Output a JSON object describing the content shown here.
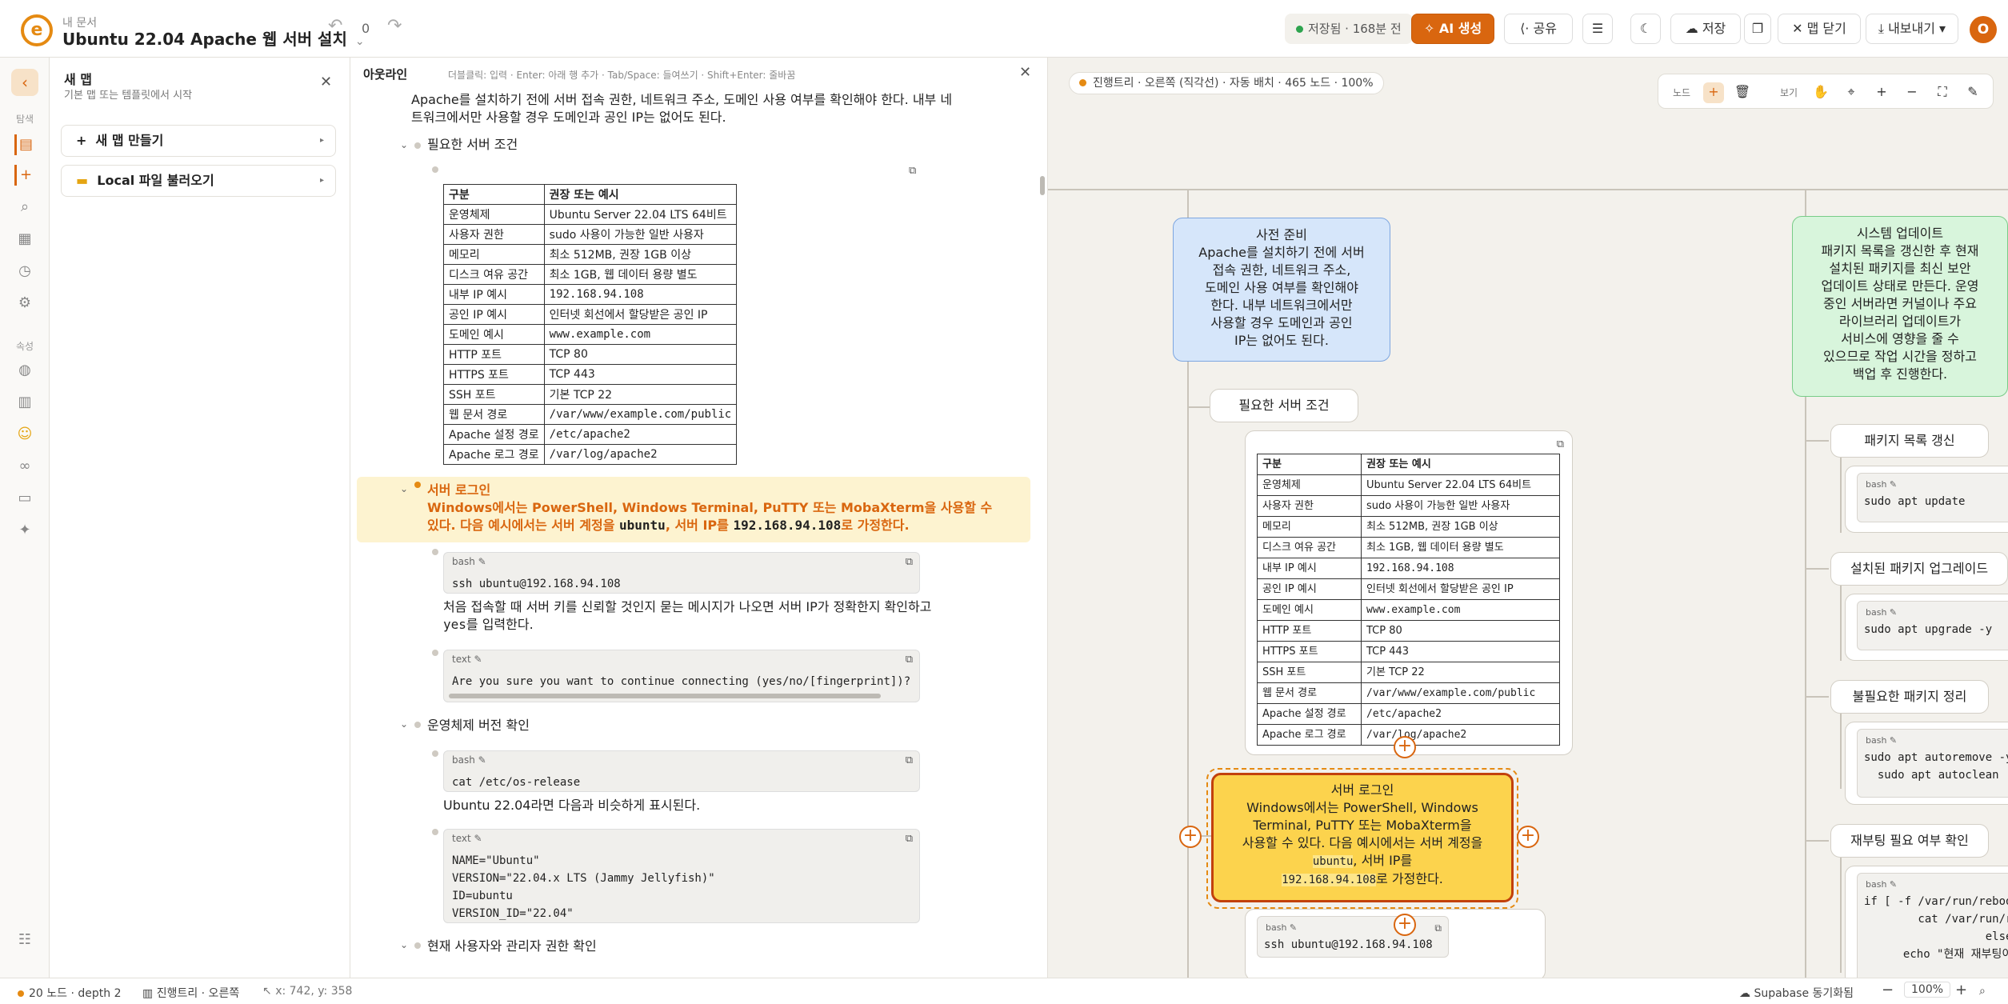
{
  "header": {
    "breadcrumb": "내 문서",
    "title": "Ubuntu 22.04 Apache 웹 서버 설치",
    "history_count": "0",
    "saved_status": "저장됨 · 168분 전",
    "ai_label": "AI 생성",
    "share_label": "공유",
    "save_label": "저장",
    "close_map_label": "맵 닫기",
    "export_label": "내보내기",
    "avatar_initial": "O"
  },
  "rail": {
    "nav_label": "탐색",
    "attr_label": "속성"
  },
  "sidebar": {
    "title": "새 맵",
    "subtitle": "기본 맵 또는 템플릿에서 시작",
    "items": [
      {
        "label": "새 맵 만들기"
      },
      {
        "label": "Local 파일 불러오기"
      }
    ]
  },
  "outline": {
    "title": "아웃라인",
    "hint": "더블클릭: 입력 · Enter: 아래 행 추가 · Tab/Space: 들여쓰기 · Shift+Enter: 줄바꿈",
    "intro_l1": "Apache를 설치하기 전에 서버 접속 권한, 네트워크 주소, 도메인 사용 여부를 확인해야 한다. 내부 네",
    "intro_l2": "트워크에서만 사용할 경우 도메인과 공인 IP는 없어도 된다.",
    "req_heading": "필요한 서버 조건",
    "table_headers": [
      "구분",
      "권장 또는 예시"
    ],
    "table_rows": [
      [
        "운영체제",
        "Ubuntu Server 22.04 LTS 64비트"
      ],
      [
        "사용자 권한",
        "sudo 사용이 가능한 일반 사용자"
      ],
      [
        "메모리",
        "최소 512MB, 권장 1GB 이상"
      ],
      [
        "디스크 여유 공간",
        "최소 1GB, 웹 데이터 용량 별도"
      ],
      [
        "내부 IP 예시",
        "192.168.94.108"
      ],
      [
        "공인 IP 예시",
        "인터넷 회선에서 할당받은 공인 IP"
      ],
      [
        "도메인 예시",
        "www.example.com"
      ],
      [
        "HTTP 포트",
        "TCP 80"
      ],
      [
        "HTTPS 포트",
        "TCP 443"
      ],
      [
        "SSH 포트",
        "기본 TCP 22"
      ],
      [
        "웹 문서 경로",
        "/var/www/example.com/public"
      ],
      [
        "Apache 설정 경로",
        "/etc/apache2"
      ],
      [
        "Apache 로그 경로",
        "/var/log/apache2"
      ]
    ],
    "login_heading": "서버 로그인",
    "login_l1": "Windows에서는 PowerShell, Windows Terminal, PuTTY 또는 MobaXterm을 사용할 수",
    "login_l2a": "있다. 다음 예시에서는 서버 계정을 ",
    "login_user": "ubuntu",
    "login_l2b": ", 서버 IP를 ",
    "login_ip": "192.168.94.108",
    "login_l2c": "로 가정한다.",
    "ssh_lang": "bash ✎",
    "ssh_code": "ssh ubuntu@192.168.94.108",
    "ssh_note_l1": "처음 접속할 때 서버 키를 신뢰할 것인지 묻는 메시지가 나오면 서버 IP가 정확한지 확인하고",
    "ssh_note_yes": "yes",
    "ssh_note_l2": "를 입력한다.",
    "fp_lang": "text ✎",
    "fp_code": "Are you sure you want to continue connecting (yes/no/[fingerprint])?",
    "os_heading": "운영체제 버전 확인",
    "os_lang": "bash ✎",
    "os_code": "cat /etc/os-release",
    "os_note": "Ubuntu 22.04라면 다음과 비슷하게 표시된다.",
    "osout_lang": "text ✎",
    "osout_code": "NAME=\"Ubuntu\"\nVERSION=\"22.04.x LTS (Jammy Jellyfish)\"\nID=ubuntu\nVERSION_ID=\"22.04\"",
    "user_heading": "현재 사용자와 관리자 권한 확인"
  },
  "canvas": {
    "info": "진행트리 · 오른쪽 (직각선) · 자동 배치 · 465 노드 · 100%",
    "tools_node_label": "노드",
    "tools_view_label": "보기",
    "prep_node": "사전 준비\nApache를 설치하기 전에 서버\n접속 권한, 네트워크 주소,\n도메인 사용 여부를 확인해야\n한다. 내부 네트워크에서만\n사용할 경우 도메인과 공인\nIP는 없어도 된다.",
    "update_node": "시스템 업데이트\n패키지 목록을 갱신한 후 현재\n설치된 패키지를 최신 보안\n업데이트 상태로 만든다. 운영\n중인 서버라면 커널이나 주요\n라이브러리 업데이트가\n서비스에 영향을 줄 수\n있으므로 작업 시간을 정하고\n백업 후 진행한다.",
    "req_node": "필요한 서버 조건",
    "login_node_l1": "서버 로그인",
    "login_node_l2": "Windows에서는 PowerShell, Windows",
    "login_node_l3": "Terminal, PuTTY 또는 MobaXterm을",
    "login_node_l4": "사용할 수 있다. 다음 예시에서는 서버 계정을",
    "login_node_user": "ubuntu",
    "login_node_l5b": ", 서버 IP를",
    "login_node_ip": "192.168.94.108",
    "login_node_l6b": "로 가정한다.",
    "ssh_node_lang": "bash ✎",
    "ssh_node_code": "ssh ubuntu@192.168.94.108",
    "pkg_refresh": "패키지 목록 갱신",
    "pkg_refresh_code": "sudo apt update",
    "pkg_upgrade": "설치된 패키지 업그레이드",
    "pkg_upgrade_code": "sudo apt upgrade -y",
    "pkg_clean": "불필요한 패키지 정리",
    "pkg_clean_code": "sudo apt autoremove -y\nsudo apt autoclean",
    "reboot_check": "재부팅 필요 여부 확인",
    "reboot_code": "if [ -f /var/run/reboot-required ]; then\n    cat /var/run/reboot-required\nelse\n    echo \"현재 재부팅이 필요하지 않습니다.\""
  },
  "footer": {
    "nodes": "20 노드 · depth 2",
    "layout": "진행트리 · 오른쪽",
    "coords": "x: 742, y: 358",
    "sync": "Supabase 동기화됨",
    "zoom": "100%"
  },
  "colors": {
    "accent": "#d9660f",
    "saved": "#2ea44f",
    "highlight": "#fcd34d"
  }
}
